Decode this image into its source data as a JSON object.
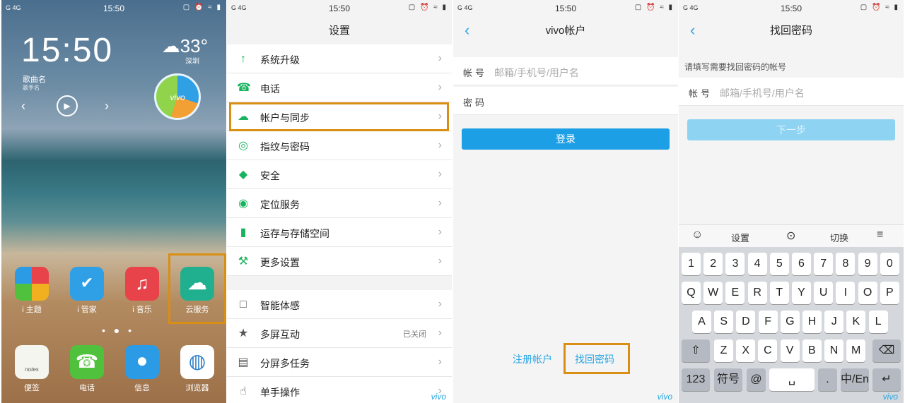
{
  "screen1": {
    "status": {
      "left": "G 4G",
      "time": "15:50",
      "right": "▢ ⏰ ≈ ▮"
    },
    "clock": "15:50",
    "weather": {
      "temp": "33°",
      "city": "深圳"
    },
    "music": {
      "song": "歌曲名",
      "singer": "歌手名",
      "prev": "‹",
      "next": "›",
      "play": "▶"
    },
    "disc_label": "vivo",
    "apps": [
      {
        "label": "i 主题",
        "color": "#f0b020"
      },
      {
        "label": "i 管家",
        "color": "#2fa0e6"
      },
      {
        "label": "i 音乐",
        "color": "#e8424a"
      },
      {
        "label": "云服务",
        "color": "#21b08f"
      }
    ],
    "dock": [
      {
        "label": "便签",
        "color": "#f5f5f0"
      },
      {
        "label": "电话",
        "color": "#4fc13c"
      },
      {
        "label": "信息",
        "color": "#2b9be6"
      },
      {
        "label": "浏览器",
        "color": "#ffffff"
      }
    ],
    "notes_text": "notes",
    "page_dots": "• ● •"
  },
  "screen2": {
    "status": {
      "left": "G 4G",
      "time": "15:50",
      "right": "▢ ⏰ ≈ ▮"
    },
    "title": "设置",
    "group1": [
      {
        "label": "系统升级",
        "icon": "arrow-up-icon",
        "glyph": "↑"
      },
      {
        "label": "电话",
        "icon": "phone-icon",
        "glyph": "☎"
      },
      {
        "label": "帐户与同步",
        "icon": "cloud-icon",
        "glyph": "☁"
      },
      {
        "label": "指纹与密码",
        "icon": "fingerprint-icon",
        "glyph": "◎"
      },
      {
        "label": "安全",
        "icon": "shield-icon",
        "glyph": "◆"
      },
      {
        "label": "定位服务",
        "icon": "location-icon",
        "glyph": "◉"
      },
      {
        "label": "运存与存储空间",
        "icon": "storage-icon",
        "glyph": "▮"
      },
      {
        "label": "更多设置",
        "icon": "wrench-icon",
        "glyph": "⚒"
      }
    ],
    "group2": [
      {
        "label": "智能体感",
        "icon": "motion-icon",
        "glyph": "□",
        "status": ""
      },
      {
        "label": "多屏互动",
        "icon": "multiscreen-icon",
        "glyph": "★",
        "status": "已关闭"
      },
      {
        "label": "分屏多任务",
        "icon": "splitscreen-icon",
        "glyph": "▤",
        "status": ""
      },
      {
        "label": "单手操作",
        "icon": "onehand-icon",
        "glyph": "☝",
        "status": ""
      }
    ],
    "watermark": "vivo"
  },
  "screen3": {
    "status": {
      "left": "G 4G",
      "time": "15:50",
      "right": "▢ ⏰ ≈ ▮"
    },
    "title": "vivo帐户",
    "account_label": "帐号",
    "account_placeholder": "邮箱/手机号/用户名",
    "password_label": "密码",
    "login": "登录",
    "register": "注册帐户",
    "forgot": "找回密码",
    "watermark": "vivo"
  },
  "screen4": {
    "status": {
      "left": "G 4G",
      "time": "15:50",
      "right": "▢ ⏰ ≈ ▮"
    },
    "title": "找回密码",
    "hint": "请填写需要找回密码的帐号",
    "account_label": "帐号",
    "account_placeholder": "邮箱/手机号/用户名",
    "next": "下一步",
    "toolbar": {
      "emoji": "☺",
      "settings": "设置",
      "mic": "⊙",
      "switch": "切换",
      "collapse": "≡"
    },
    "keys": {
      "row0": [
        "1",
        "2",
        "3",
        "4",
        "5",
        "6",
        "7",
        "8",
        "9",
        "0"
      ],
      "row1": [
        "Q",
        "W",
        "E",
        "R",
        "T",
        "Y",
        "U",
        "I",
        "O",
        "P"
      ],
      "row2": [
        "A",
        "S",
        "D",
        "F",
        "G",
        "H",
        "J",
        "K",
        "L"
      ],
      "row3": [
        "Z",
        "X",
        "C",
        "V",
        "B",
        "N",
        "M"
      ],
      "shift": "⇧",
      "backspace": "⌫",
      "num": "123",
      "symbol": "符号",
      "at": "@",
      "space": "␣",
      "dot": ".",
      "lang": "中/En",
      "enter": "↵"
    },
    "watermark": "vivo"
  }
}
